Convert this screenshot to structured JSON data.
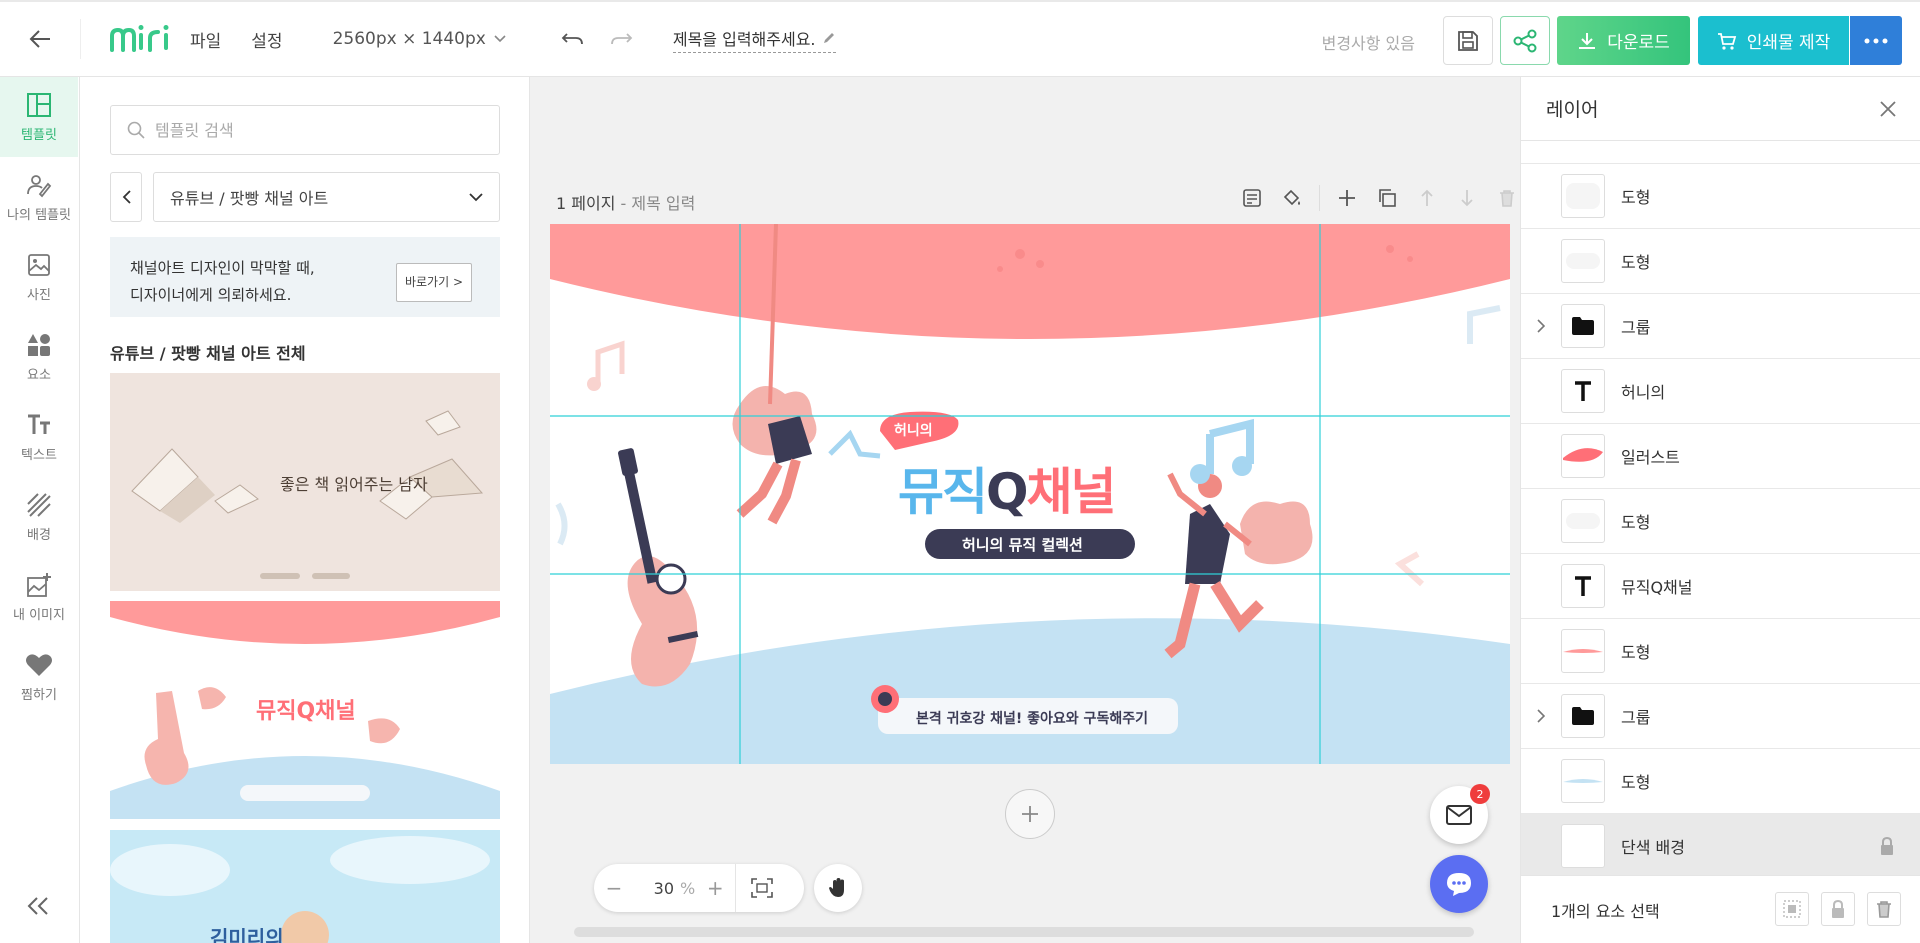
{
  "topbar": {
    "logo": "miri",
    "menu": [
      "파일",
      "설정"
    ],
    "size": "2560px × 1440px",
    "title": "제목을 입력해주세요.",
    "status": "변경사항 있음",
    "download": "다운로드",
    "print": "인쇄물 제작"
  },
  "leftnav": [
    {
      "label": "템플릿",
      "icon": "template-icon"
    },
    {
      "label": "나의 템플릿",
      "icon": "my-template-icon"
    },
    {
      "label": "사진",
      "icon": "photo-icon"
    },
    {
      "label": "요소",
      "icon": "elements-icon"
    },
    {
      "label": "텍스트",
      "icon": "text-icon"
    },
    {
      "label": "배경",
      "icon": "background-icon"
    },
    {
      "label": "내 이미지",
      "icon": "my-image-icon"
    },
    {
      "label": "찜하기",
      "icon": "heart-icon"
    }
  ],
  "panel": {
    "search_placeholder": "템플릿 검색",
    "category": "유튜브 / 팟빵 채널 아트",
    "promo_line1": "채널아트 디자인이 막막할 때,",
    "promo_line2": "디자이너에게 의뢰하세요.",
    "promo_button": "바로가기 >",
    "section_title": "유튜브 / 팟빵 채널 아트 전체",
    "thumb1_text": "좋은 책 읽어주는 남자",
    "thumb2_title": "뮤직Q채널",
    "thumb3_text": "김미리의"
  },
  "canvas": {
    "page_num": "1 페이지",
    "page_title": "- 제목 입력",
    "badge": "허니의",
    "main_title_a": "뮤직",
    "main_title_b": "Q",
    "main_title_c": "채널",
    "subtitle": "허니의 뮤직 컬렉션",
    "banner": "본격 귀호강 채널! 좋아요와 구독해주기",
    "zoom": "30",
    "zoom_unit": "%",
    "mail_count": "2"
  },
  "layers": {
    "title": "레이어",
    "items": [
      {
        "name": "도형",
        "type": "shape",
        "group": false
      },
      {
        "name": "도형",
        "type": "shape",
        "group": false
      },
      {
        "name": "그룹",
        "type": "group",
        "group": true
      },
      {
        "name": "허니의",
        "type": "text",
        "group": false
      },
      {
        "name": "일러스트",
        "type": "illust",
        "group": false
      },
      {
        "name": "도형",
        "type": "shape",
        "group": false
      },
      {
        "name": "뮤직Q채널",
        "type": "text",
        "group": false
      },
      {
        "name": "도형",
        "type": "shape-pink",
        "group": false
      },
      {
        "name": "그룹",
        "type": "group",
        "group": true
      },
      {
        "name": "도형",
        "type": "shape-blue",
        "group": false
      },
      {
        "name": "단색 배경",
        "type": "bg",
        "group": false
      }
    ],
    "footer": "1개의 요소 선택"
  },
  "colors": {
    "accent_green": "#2bb673",
    "coral": "#ff9a9a",
    "sky": "#c4e2f3",
    "print": "#1bbfcf",
    "more": "#2f7fd9"
  }
}
